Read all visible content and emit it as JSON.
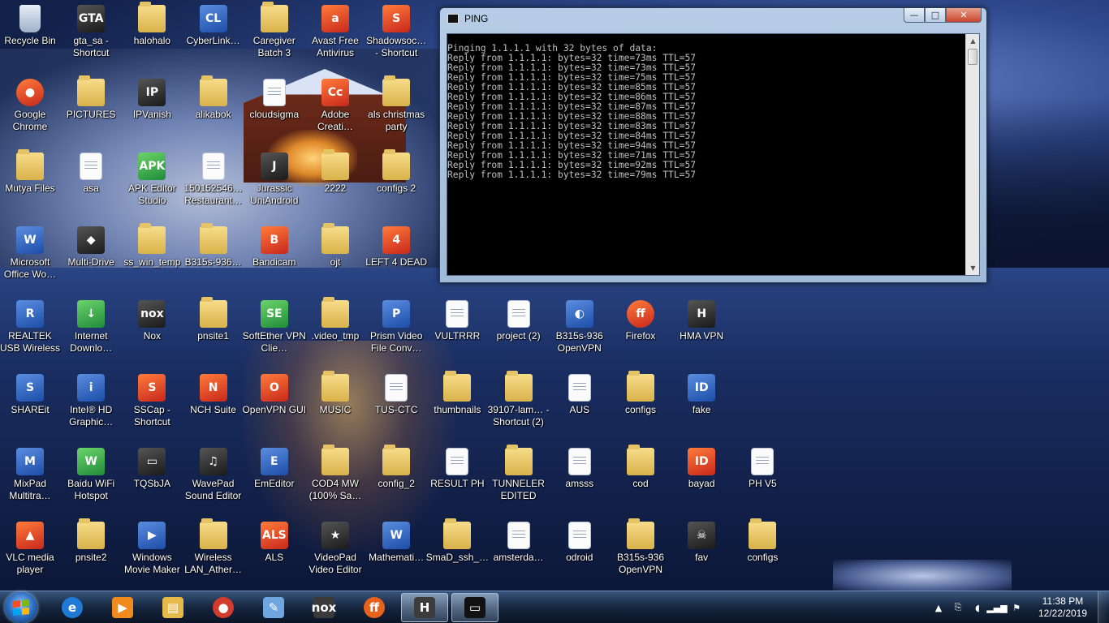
{
  "desktop": {
    "icons": [
      {
        "label": "Recycle Bin",
        "kind": "bin",
        "glyph": "",
        "col": 0,
        "row": 0
      },
      {
        "label": "gta_sa - Shortcut",
        "kind": "dark",
        "glyph": "GTA",
        "col": 1,
        "row": 0
      },
      {
        "label": "halohalo",
        "kind": "folder",
        "glyph": "",
        "col": 2,
        "row": 0
      },
      {
        "label": "CyberLink…",
        "kind": "app",
        "glyph": "CL",
        "col": 3,
        "row": 0
      },
      {
        "label": "Caregiver Batch 3",
        "kind": "folder",
        "glyph": "",
        "col": 4,
        "row": 0
      },
      {
        "label": "Avast Free Antivirus",
        "kind": "red",
        "glyph": "a",
        "col": 5,
        "row": 0
      },
      {
        "label": "Shadowsoc… - Shortcut",
        "kind": "red",
        "glyph": "S",
        "col": 6,
        "row": 0
      },
      {
        "label": "Google Chrome",
        "kind": "red",
        "glyph": "●",
        "col": 0,
        "row": 1
      },
      {
        "label": "PICTURES",
        "kind": "folder",
        "glyph": "",
        "col": 1,
        "row": 1
      },
      {
        "label": "IPVanish",
        "kind": "dark",
        "glyph": "IP",
        "col": 2,
        "row": 1
      },
      {
        "label": "alikabok",
        "kind": "folder",
        "glyph": "",
        "col": 3,
        "row": 1
      },
      {
        "label": "cloudsigma",
        "kind": "doc",
        "glyph": "",
        "col": 4,
        "row": 1
      },
      {
        "label": "Adobe Creati…",
        "kind": "red",
        "glyph": "Cc",
        "col": 5,
        "row": 1
      },
      {
        "label": "als christmas party",
        "kind": "folder",
        "glyph": "",
        "col": 6,
        "row": 1
      },
      {
        "label": "Mutya Files",
        "kind": "folder",
        "glyph": "",
        "col": 0,
        "row": 2
      },
      {
        "label": "asa",
        "kind": "doc",
        "glyph": "",
        "col": 1,
        "row": 2
      },
      {
        "label": "APK Editor Studio",
        "kind": "green",
        "glyph": "APK",
        "col": 2,
        "row": 2
      },
      {
        "label": "150152546… Restaurant…",
        "kind": "doc",
        "glyph": "",
        "col": 3,
        "row": 2
      },
      {
        "label": "Jurassic UniAndroid",
        "kind": "dark",
        "glyph": "J",
        "col": 4,
        "row": 2
      },
      {
        "label": "2222",
        "kind": "folder",
        "glyph": "",
        "col": 5,
        "row": 2
      },
      {
        "label": "configs 2",
        "kind": "folder",
        "glyph": "",
        "col": 6,
        "row": 2
      },
      {
        "label": "Microsoft Office Wo…",
        "kind": "app",
        "glyph": "W",
        "col": 0,
        "row": 3
      },
      {
        "label": "Multi-Drive",
        "kind": "dark",
        "glyph": "◆",
        "col": 1,
        "row": 3
      },
      {
        "label": "ss_win_temp",
        "kind": "folder",
        "glyph": "",
        "col": 2,
        "row": 3
      },
      {
        "label": "B315s-936…",
        "kind": "folder",
        "glyph": "",
        "col": 3,
        "row": 3
      },
      {
        "label": "Bandicam",
        "kind": "red",
        "glyph": "B",
        "col": 4,
        "row": 3
      },
      {
        "label": "ojt",
        "kind": "folder",
        "glyph": "",
        "col": 5,
        "row": 3
      },
      {
        "label": "LEFT 4 DEAD",
        "kind": "red",
        "glyph": "4",
        "col": 6,
        "row": 3
      },
      {
        "label": "REALTEK USB Wireless LA…",
        "kind": "app",
        "glyph": "R",
        "col": 0,
        "row": 4
      },
      {
        "label": "Internet Downlo…",
        "kind": "green",
        "glyph": "↓",
        "col": 1,
        "row": 4
      },
      {
        "label": "Nox",
        "kind": "dark",
        "glyph": "nox",
        "col": 2,
        "row": 4
      },
      {
        "label": "pnsite1",
        "kind": "folder",
        "glyph": "",
        "col": 3,
        "row": 4
      },
      {
        "label": "SoftEther VPN Clie…",
        "kind": "green",
        "glyph": "SE",
        "col": 4,
        "row": 4
      },
      {
        "label": ".video_tmp",
        "kind": "folder",
        "glyph": "",
        "col": 5,
        "row": 4
      },
      {
        "label": "Prism Video File Conv…",
        "kind": "app",
        "glyph": "P",
        "col": 6,
        "row": 4
      },
      {
        "label": "VULTRRR",
        "kind": "doc",
        "glyph": "",
        "col": 7,
        "row": 4
      },
      {
        "label": "project (2)",
        "kind": "doc",
        "glyph": "",
        "col": 8,
        "row": 4
      },
      {
        "label": "B315s-936 OpenVPN",
        "kind": "app",
        "glyph": "◐",
        "col": 9,
        "row": 4
      },
      {
        "label": "Firefox",
        "kind": "red",
        "glyph": "ff",
        "col": 10,
        "row": 4
      },
      {
        "label": "HMA VPN",
        "kind": "dark",
        "glyph": "H",
        "col": 11,
        "row": 4
      },
      {
        "label": "SHAREit",
        "kind": "app",
        "glyph": "S",
        "col": 0,
        "row": 5
      },
      {
        "label": "Intel® HD Graphic…",
        "kind": "app",
        "glyph": "i",
        "col": 1,
        "row": 5
      },
      {
        "label": "SSCap - Shortcut",
        "kind": "red",
        "glyph": "S",
        "col": 2,
        "row": 5
      },
      {
        "label": "NCH Suite",
        "kind": "red",
        "glyph": "N",
        "col": 3,
        "row": 5
      },
      {
        "label": "OpenVPN GUI",
        "kind": "red",
        "glyph": "O",
        "col": 4,
        "row": 5
      },
      {
        "label": "MUSIC",
        "kind": "folder",
        "glyph": "",
        "col": 5,
        "row": 5
      },
      {
        "label": "TUS-CTC",
        "kind": "doc",
        "glyph": "",
        "col": 6,
        "row": 5
      },
      {
        "label": "thumbnails",
        "kind": "folder",
        "glyph": "",
        "col": 7,
        "row": 5
      },
      {
        "label": "39107-lam… - Shortcut (2)",
        "kind": "folder",
        "glyph": "",
        "col": 8,
        "row": 5
      },
      {
        "label": "AUS",
        "kind": "doc",
        "glyph": "",
        "col": 9,
        "row": 5
      },
      {
        "label": "configs",
        "kind": "folder",
        "glyph": "",
        "col": 10,
        "row": 5
      },
      {
        "label": "fake",
        "kind": "app",
        "glyph": "ID",
        "col": 11,
        "row": 5
      },
      {
        "label": "MixPad Multitra…",
        "kind": "app",
        "glyph": "M",
        "col": 0,
        "row": 6
      },
      {
        "label": "Baidu WiFi Hotspot",
        "kind": "green",
        "glyph": "W",
        "col": 1,
        "row": 6
      },
      {
        "label": "TQSbJA",
        "kind": "dark",
        "glyph": "▭",
        "col": 2,
        "row": 6
      },
      {
        "label": "WavePad Sound Editor",
        "kind": "dark",
        "glyph": "♫",
        "col": 3,
        "row": 6
      },
      {
        "label": "EmEditor",
        "kind": "app",
        "glyph": "E",
        "col": 4,
        "row": 6
      },
      {
        "label": "COD4 MW (100% Sa…",
        "kind": "folder",
        "glyph": "",
        "col": 5,
        "row": 6
      },
      {
        "label": "config_2",
        "kind": "folder",
        "glyph": "",
        "col": 6,
        "row": 6
      },
      {
        "label": "RESULT PH",
        "kind": "doc",
        "glyph": "",
        "col": 7,
        "row": 6
      },
      {
        "label": "TUNNELER EDITED",
        "kind": "folder",
        "glyph": "",
        "col": 8,
        "row": 6
      },
      {
        "label": "amsss",
        "kind": "doc",
        "glyph": "",
        "col": 9,
        "row": 6
      },
      {
        "label": "cod",
        "kind": "folder",
        "glyph": "",
        "col": 10,
        "row": 6
      },
      {
        "label": "bayad",
        "kind": "red",
        "glyph": "ID",
        "col": 11,
        "row": 6
      },
      {
        "label": "PH V5",
        "kind": "doc",
        "glyph": "",
        "col": 12,
        "row": 6
      },
      {
        "label": "VLC media player",
        "kind": "red",
        "glyph": "▲",
        "col": 0,
        "row": 7
      },
      {
        "label": "pnsite2",
        "kind": "folder",
        "glyph": "",
        "col": 1,
        "row": 7
      },
      {
        "label": "Windows Movie Maker",
        "kind": "app",
        "glyph": "▶",
        "col": 2,
        "row": 7
      },
      {
        "label": "Wireless LAN_Ather…",
        "kind": "folder",
        "glyph": "",
        "col": 3,
        "row": 7
      },
      {
        "label": "ALS",
        "kind": "red",
        "glyph": "ALS",
        "col": 4,
        "row": 7
      },
      {
        "label": "VideoPad Video Editor",
        "kind": "dark",
        "glyph": "★",
        "col": 5,
        "row": 7
      },
      {
        "label": "Mathemati…",
        "kind": "app",
        "glyph": "W",
        "col": 6,
        "row": 7
      },
      {
        "label": "SmaD_ssh_…",
        "kind": "folder",
        "glyph": "",
        "col": 7,
        "row": 7
      },
      {
        "label": "amsterda…",
        "kind": "doc",
        "glyph": "",
        "col": 8,
        "row": 7
      },
      {
        "label": "odroid",
        "kind": "doc",
        "glyph": "",
        "col": 9,
        "row": 7
      },
      {
        "label": "B315s-936 OpenVPN",
        "kind": "folder",
        "glyph": "",
        "col": 10,
        "row": 7
      },
      {
        "label": "fav",
        "kind": "dark",
        "glyph": "☠",
        "col": 11,
        "row": 7
      },
      {
        "label": "configs",
        "kind": "folder",
        "glyph": "",
        "col": 12,
        "row": 7
      }
    ]
  },
  "ping_window": {
    "title": "PING",
    "minimize_glyph": "—",
    "maximize_glyph": "□",
    "close_glyph": "✕",
    "lines": [
      "Pinging 1.1.1.1 with 32 bytes of data:",
      "Reply from 1.1.1.1: bytes=32 time=73ms TTL=57",
      "Reply from 1.1.1.1: bytes=32 time=73ms TTL=57",
      "Reply from 1.1.1.1: bytes=32 time=75ms TTL=57",
      "Reply from 1.1.1.1: bytes=32 time=85ms TTL=57",
      "Reply from 1.1.1.1: bytes=32 time=86ms TTL=57",
      "Reply from 1.1.1.1: bytes=32 time=87ms TTL=57",
      "Reply from 1.1.1.1: bytes=32 time=88ms TTL=57",
      "Reply from 1.1.1.1: bytes=32 time=83ms TTL=57",
      "Reply from 1.1.1.1: bytes=32 time=84ms TTL=57",
      "Reply from 1.1.1.1: bytes=32 time=94ms TTL=57",
      "Reply from 1.1.1.1: bytes=32 time=71ms TTL=57",
      "Reply from 1.1.1.1: bytes=32 time=92ms TTL=57",
      "Reply from 1.1.1.1: bytes=32 time=79ms TTL=57"
    ]
  },
  "taskbar": {
    "items": [
      {
        "name": "internet-explorer",
        "glyph": "e",
        "color": "#1f7ad6",
        "active": false
      },
      {
        "name": "windows-media-player",
        "glyph": "▶",
        "color": "#f08a1e",
        "active": false
      },
      {
        "name": "file-explorer",
        "glyph": "▤",
        "color": "#e5b94a",
        "active": false
      },
      {
        "name": "google-chrome",
        "glyph": "●",
        "color": "#d33b2c",
        "active": false
      },
      {
        "name": "notepad",
        "glyph": "✎",
        "color": "#6fa6e0",
        "active": false
      },
      {
        "name": "nox",
        "glyph": "nox",
        "color": "#3a3a3a",
        "active": false
      },
      {
        "name": "firefox",
        "glyph": "ff",
        "color": "#e8621c",
        "active": false
      },
      {
        "name": "hma-vpn",
        "glyph": "H",
        "color": "#3c3c3c",
        "active": true
      },
      {
        "name": "command-prompt",
        "glyph": "▭",
        "color": "#111111",
        "active": true
      }
    ],
    "tray": {
      "show_hidden_glyph": "▲",
      "time": "11:38 PM",
      "date": "12/22/2019"
    }
  }
}
